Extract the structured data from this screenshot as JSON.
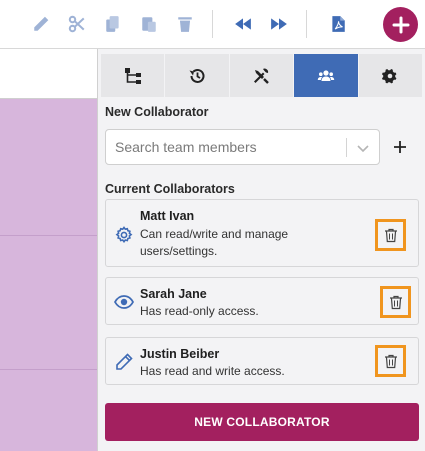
{
  "toolbar": {
    "icons": [
      "pencil-icon",
      "scissors-icon",
      "copy-icon",
      "paste-icon",
      "trash-icon",
      "rewind-icon",
      "fast-forward-icon",
      "pdf-icon",
      "plus-icon"
    ],
    "accent_color": "#3f6bb5",
    "brand_color": "#a3205f"
  },
  "panel": {
    "tabs": [
      {
        "icon": "sitemap-icon",
        "active": false
      },
      {
        "icon": "history-icon",
        "active": false
      },
      {
        "icon": "tools-icon",
        "active": false
      },
      {
        "icon": "users-icon",
        "active": true
      },
      {
        "icon": "gear-icon",
        "active": false
      }
    ],
    "new_collaborator_label": "New Collaborator",
    "search": {
      "placeholder": "Search team members",
      "value": ""
    },
    "current_collaborators_label": "Current Collaborators",
    "collaborators": [
      {
        "name": "Matt Ivan",
        "description": "Can read/write and manage users/settings.",
        "icon": "gear-icon"
      },
      {
        "name": "Sarah Jane",
        "description": "Has read-only access.",
        "icon": "eye-icon"
      },
      {
        "name": "Justin Beiber",
        "description": "Has read and write access.",
        "icon": "pencil-icon"
      }
    ],
    "new_collaborator_button": "NEW COLLABORATOR",
    "highlight_color": "#f0951f"
  }
}
